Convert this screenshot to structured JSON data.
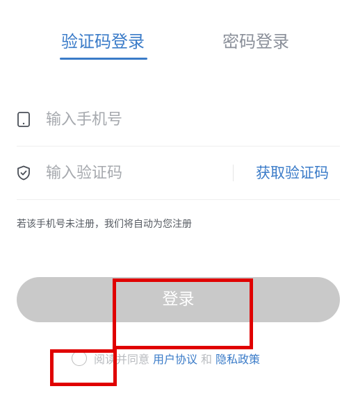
{
  "tabs": {
    "active_label": "验证码登录",
    "inactive_label": "密码登录"
  },
  "phone": {
    "icon": "phone-icon",
    "placeholder": "输入手机号"
  },
  "code": {
    "icon": "shield-check-icon",
    "placeholder": "输入验证码",
    "get_code_label": "获取验证码"
  },
  "hint_text": "若该手机号未注册，我们将自动为您注册",
  "login_label": "登录",
  "agreement": {
    "prefix": "阅读并同意",
    "user_agreement": "用户协议",
    "and": "和",
    "privacy_policy": "隐私政策"
  },
  "colors": {
    "accent": "#3a7bc8",
    "button_disabled": "#c9c9c9",
    "annotation": "#e00000"
  }
}
